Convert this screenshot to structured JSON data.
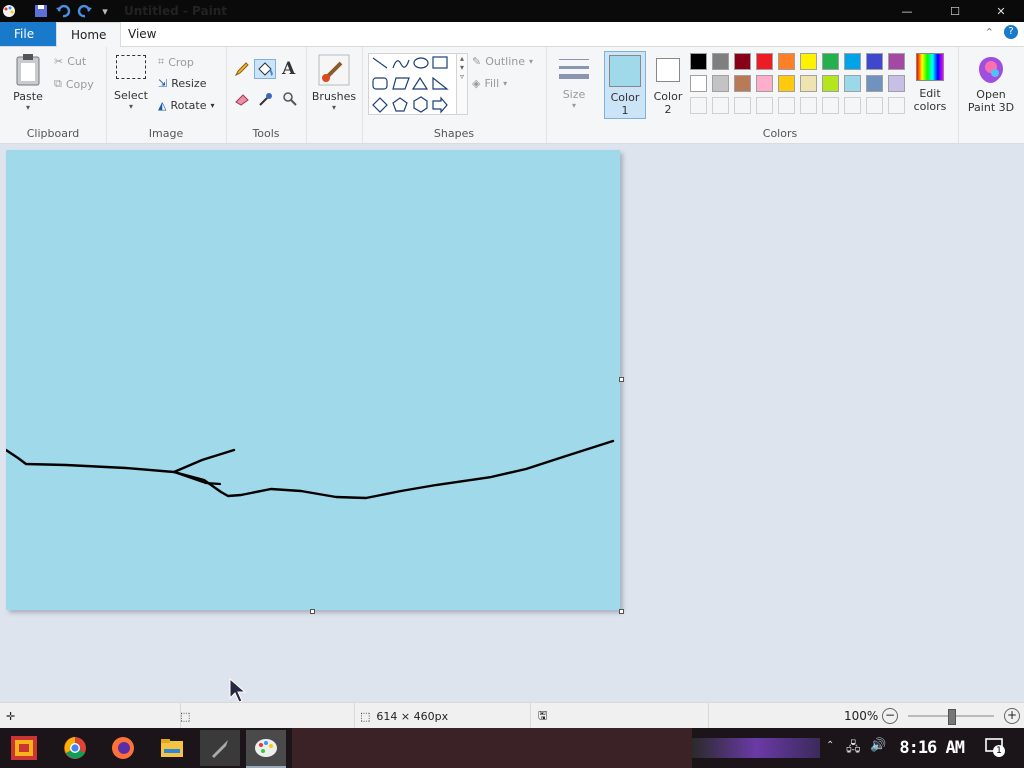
{
  "titlebar": {
    "title": "Untitled - Paint",
    "minimize": "—",
    "maximize": "☐",
    "close": "✕"
  },
  "tabs": {
    "file": "File",
    "home": "Home",
    "view": "View"
  },
  "clipboard": {
    "paste": "Paste",
    "cut": "Cut",
    "copy": "Copy",
    "label": "Clipboard"
  },
  "image": {
    "select": "Select",
    "crop": "Crop",
    "resize": "Resize",
    "rotate": "Rotate",
    "label": "Image"
  },
  "tools": {
    "label": "Tools",
    "text_glyph": "A"
  },
  "brushes": {
    "label": "Brushes"
  },
  "shapes": {
    "outline": "Outline",
    "fill": "Fill",
    "label": "Shapes"
  },
  "size": {
    "label": "Size"
  },
  "colors": {
    "color1": "Color 1",
    "color1_line1": "Color",
    "color1_line2": "1",
    "color2_line1": "Color",
    "color2_line2": "2",
    "edit_line1": "Edit",
    "edit_line2": "colors",
    "label": "Colors",
    "color1_value": "#9fd9ea",
    "color2_value": "#ffffff",
    "palette_row1": [
      "#000000",
      "#7f7f7f",
      "#880015",
      "#ed1c24",
      "#ff7f27",
      "#fff200",
      "#22b14c",
      "#00a2e8",
      "#3f48cc",
      "#a349a4"
    ],
    "palette_row2": [
      "#ffffff",
      "#c3c3c3",
      "#b97a57",
      "#ffaec9",
      "#ffc90e",
      "#efe4b0",
      "#b5e61d",
      "#99d9ea",
      "#7092be",
      "#c8bfe7"
    ]
  },
  "paint3d": {
    "line1": "Open",
    "line2": "Paint 3D"
  },
  "canvas": {
    "background": "#9fd9ea"
  },
  "status": {
    "dimensions": "614 × 460px",
    "zoom": "100%",
    "zoom_level": 1.0
  },
  "taskbar": {
    "time": "8:16 AM",
    "notifications": "1"
  }
}
